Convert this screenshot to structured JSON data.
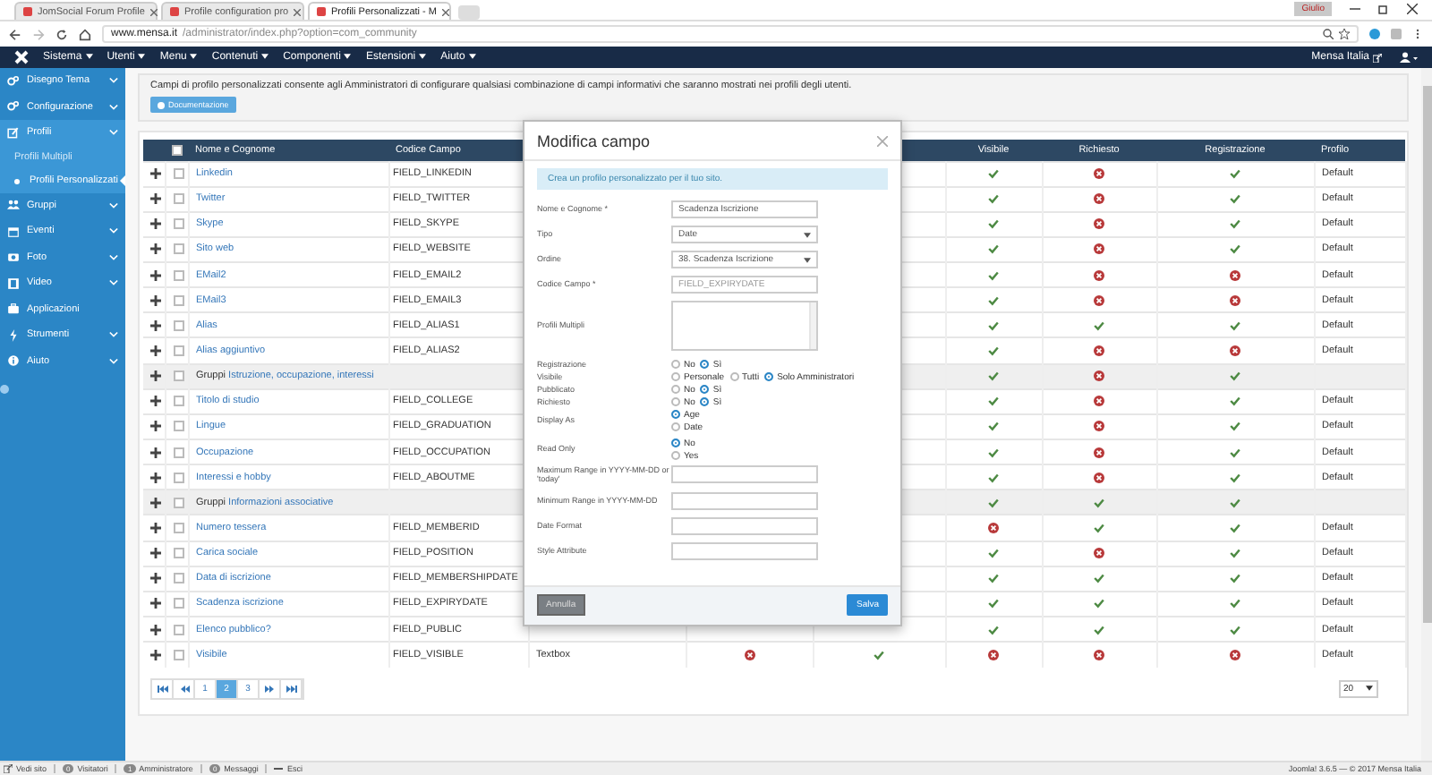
{
  "browser": {
    "tabs": [
      {
        "title": "JomSocial Forum Profile",
        "selected": false
      },
      {
        "title": "Profile configuration pro",
        "selected": false
      },
      {
        "title": "Profili Personalizzati - M",
        "selected": true
      }
    ],
    "address": {
      "host": "www.mensa.it",
      "path": "/administrator/index.php?option=com_community"
    },
    "profile_badge": "Giulio"
  },
  "navbar": {
    "menus": [
      "Sistema",
      "Utenti",
      "Menu",
      "Contenuti",
      "Componenti",
      "Estensioni",
      "Aiuto"
    ],
    "site_link": "Mensa Italia"
  },
  "sidebar": {
    "items": [
      {
        "label": "Disegno Tema",
        "kind": "item",
        "expandable": true,
        "expanded": false,
        "selected": false
      },
      {
        "label": "Configurazione",
        "kind": "item",
        "expandable": true,
        "expanded": false,
        "selected": false
      },
      {
        "label": "Profili",
        "kind": "item",
        "expandable": true,
        "expanded": true,
        "selected": false
      },
      {
        "label": "Profili Multipli",
        "kind": "subitem",
        "expandable": false,
        "expanded": false,
        "selected": false
      },
      {
        "label": "Profili Personalizzati",
        "kind": "subitem",
        "expandable": false,
        "expanded": false,
        "selected": true
      },
      {
        "label": "Gruppi",
        "kind": "item",
        "expandable": true,
        "expanded": false,
        "selected": false
      },
      {
        "label": "Eventi",
        "kind": "item",
        "expandable": true,
        "expanded": false,
        "selected": false
      },
      {
        "label": "Foto",
        "kind": "item",
        "expandable": true,
        "expanded": false,
        "selected": false
      },
      {
        "label": "Video",
        "kind": "item",
        "expandable": true,
        "expanded": false,
        "selected": false
      },
      {
        "label": "Applicazioni",
        "kind": "item",
        "expandable": false,
        "expanded": false,
        "selected": false
      },
      {
        "label": "Strumenti",
        "kind": "item",
        "expandable": true,
        "expanded": false,
        "selected": false
      },
      {
        "label": "Aiuto",
        "kind": "item",
        "expandable": true,
        "expanded": false,
        "selected": false
      }
    ]
  },
  "description": {
    "text": "Campi di profilo personalizzati consente agli Amministratori di configurare qualsiasi combinazione di campi informativi che saranno mostrati nei profili degli utenti.",
    "button": "Documentazione"
  },
  "table": {
    "header_checked": false,
    "columns": [
      "Nome e Cognome",
      "Codice Campo",
      "Visibile",
      "Richiesto",
      "Registrazione",
      "Profilo"
    ],
    "rows": [
      {
        "kind": "field",
        "checked": false,
        "name": "Linkedin",
        "code": "FIELD_LINKEDIN",
        "visible": true,
        "required": false,
        "registration": true,
        "profile": "Default"
      },
      {
        "kind": "field",
        "checked": false,
        "name": "Twitter",
        "code": "FIELD_TWITTER",
        "visible": true,
        "required": false,
        "registration": true,
        "profile": "Default"
      },
      {
        "kind": "field",
        "checked": false,
        "name": "Skype",
        "code": "FIELD_SKYPE",
        "visible": true,
        "required": false,
        "registration": true,
        "profile": "Default"
      },
      {
        "kind": "field",
        "checked": false,
        "name": "Sito web",
        "code": "FIELD_WEBSITE",
        "visible": true,
        "required": false,
        "registration": true,
        "profile": "Default"
      },
      {
        "kind": "field",
        "checked": false,
        "name": "EMail2",
        "code": "FIELD_EMAIL2",
        "visible": true,
        "required": false,
        "registration": false,
        "profile": "Default"
      },
      {
        "kind": "field",
        "checked": false,
        "name": "EMail3",
        "code": "FIELD_EMAIL3",
        "visible": true,
        "required": false,
        "registration": false,
        "profile": "Default"
      },
      {
        "kind": "field",
        "checked": false,
        "name": "Alias",
        "code": "FIELD_ALIAS1",
        "visible": true,
        "required": true,
        "registration": true,
        "profile": "Default"
      },
      {
        "kind": "field",
        "checked": false,
        "name": "Alias aggiuntivo",
        "code": "FIELD_ALIAS2",
        "visible": true,
        "required": false,
        "registration": false,
        "profile": "Default"
      },
      {
        "kind": "group",
        "checked": false,
        "prefix": "Gruppi",
        "name": "Istruzione, occupazione, interessi",
        "visible": true,
        "required": false,
        "registration": true
      },
      {
        "kind": "field",
        "checked": false,
        "name": "Titolo di studio",
        "code": "FIELD_COLLEGE",
        "visible": true,
        "required": false,
        "registration": true,
        "profile": "Default"
      },
      {
        "kind": "field",
        "checked": false,
        "name": "Lingue",
        "code": "FIELD_GRADUATION",
        "visible": true,
        "required": false,
        "registration": true,
        "profile": "Default"
      },
      {
        "kind": "field",
        "checked": false,
        "name": "Occupazione",
        "code": "FIELD_OCCUPATION",
        "visible": true,
        "required": false,
        "registration": true,
        "profile": "Default"
      },
      {
        "kind": "field",
        "checked": false,
        "name": "Interessi e hobby",
        "code": "FIELD_ABOUTME",
        "visible": true,
        "required": false,
        "registration": true,
        "profile": "Default"
      },
      {
        "kind": "group",
        "checked": false,
        "prefix": "Gruppi",
        "name": "Informazioni associative",
        "visible": true,
        "required": true,
        "registration": true
      },
      {
        "kind": "field",
        "checked": false,
        "name": "Numero tessera",
        "code": "FIELD_MEMBERID",
        "visible": false,
        "required": true,
        "registration": true,
        "profile": "Default"
      },
      {
        "kind": "field",
        "checked": false,
        "name": "Carica sociale",
        "code": "FIELD_POSITION",
        "visible": true,
        "required": false,
        "registration": true,
        "profile": "Default"
      },
      {
        "kind": "field",
        "checked": false,
        "name": "Data di iscrizione",
        "code": "FIELD_MEMBERSHIPDATE",
        "visible": true,
        "required": true,
        "registration": true,
        "profile": "Default"
      },
      {
        "kind": "field",
        "checked": false,
        "name": "Scadenza iscrizione",
        "code": "FIELD_EXPIRYDATE",
        "visible": true,
        "required": true,
        "registration": true,
        "profile": "Default"
      },
      {
        "kind": "field",
        "checked": false,
        "name": "Elenco pubblico?",
        "code": "FIELD_PUBLIC",
        "visible": true,
        "required": true,
        "registration": true,
        "profile": "Default"
      },
      {
        "kind": "field",
        "checked": false,
        "name": "Visibile",
        "code": "FIELD_VISIBLE",
        "column_3": "Textbox",
        "column_4": false,
        "column_5": true,
        "visible": false,
        "required": false,
        "registration": false,
        "profile": "Default"
      }
    ]
  },
  "pagination": {
    "pages": [
      {
        "label": "1",
        "selected": false
      },
      {
        "label": "2",
        "selected": true
      },
      {
        "label": "3",
        "selected": false
      }
    ],
    "per_page": "20"
  },
  "modal": {
    "title": "Modifica campo",
    "info": "Crea un profilo personalizzato per il tuo sito.",
    "fields": [
      {
        "kind": "text",
        "label": "Nome e Cognome *",
        "value": "Scadenza Iscrizione",
        "disabled": false
      },
      {
        "kind": "select",
        "label": "Tipo",
        "value": "Date"
      },
      {
        "kind": "select",
        "label": "Ordine",
        "value": "38. Scadenza Iscrizione"
      },
      {
        "kind": "text",
        "label": "Codice Campo *",
        "value": "FIELD_EXPIRYDATE",
        "disabled": true
      },
      {
        "kind": "textarea",
        "label": "Profili Multipli"
      },
      {
        "kind": "radios",
        "label": "Registrazione",
        "options": [
          {
            "label": "No",
            "selected": false
          },
          {
            "label": "Sì",
            "selected": true
          }
        ]
      },
      {
        "kind": "radios",
        "label": "Visibile",
        "options": [
          {
            "label": "Personale",
            "selected": false
          },
          {
            "label": "Tutti",
            "selected": false
          },
          {
            "label": "Solo Amministratori",
            "selected": true
          }
        ]
      },
      {
        "kind": "radios",
        "label": "Pubblicato",
        "options": [
          {
            "label": "No",
            "selected": false
          },
          {
            "label": "Sì",
            "selected": true
          }
        ]
      },
      {
        "kind": "radios",
        "label": "Richiesto",
        "options": [
          {
            "label": "No",
            "selected": false
          },
          {
            "label": "Sì",
            "selected": true
          }
        ]
      },
      {
        "kind": "stack",
        "label": "Display As",
        "options": [
          {
            "label": "Age",
            "selected": true
          },
          {
            "label": "Date",
            "selected": false
          }
        ]
      },
      {
        "kind": "stack",
        "label": "Read Only",
        "options": [
          {
            "label": "No",
            "selected": true
          },
          {
            "label": "Yes",
            "selected": false
          }
        ]
      },
      {
        "kind": "text",
        "label": "Maximum Range in YYYY-MM-DD or 'today'"
      },
      {
        "kind": "text",
        "label": "Minimum Range in YYYY-MM-DD"
      },
      {
        "kind": "text",
        "label": "Date Format"
      },
      {
        "kind": "text",
        "label": "Style Attribute"
      }
    ],
    "cancel": "Annulla",
    "save": "Salva"
  },
  "status_bar": {
    "items": [
      {
        "kind": "link",
        "label": "Vedi sito"
      },
      {
        "kind": "count",
        "count": "0",
        "label": "Visitatori"
      },
      {
        "kind": "count",
        "count": "1",
        "label": "Amministratore"
      },
      {
        "kind": "count",
        "count": "0",
        "label": "Messaggi"
      },
      {
        "kind": "logout",
        "label": "Esci"
      }
    ],
    "version": "Joomla! 3.6.5 — © 2017 Mensa Italia"
  }
}
